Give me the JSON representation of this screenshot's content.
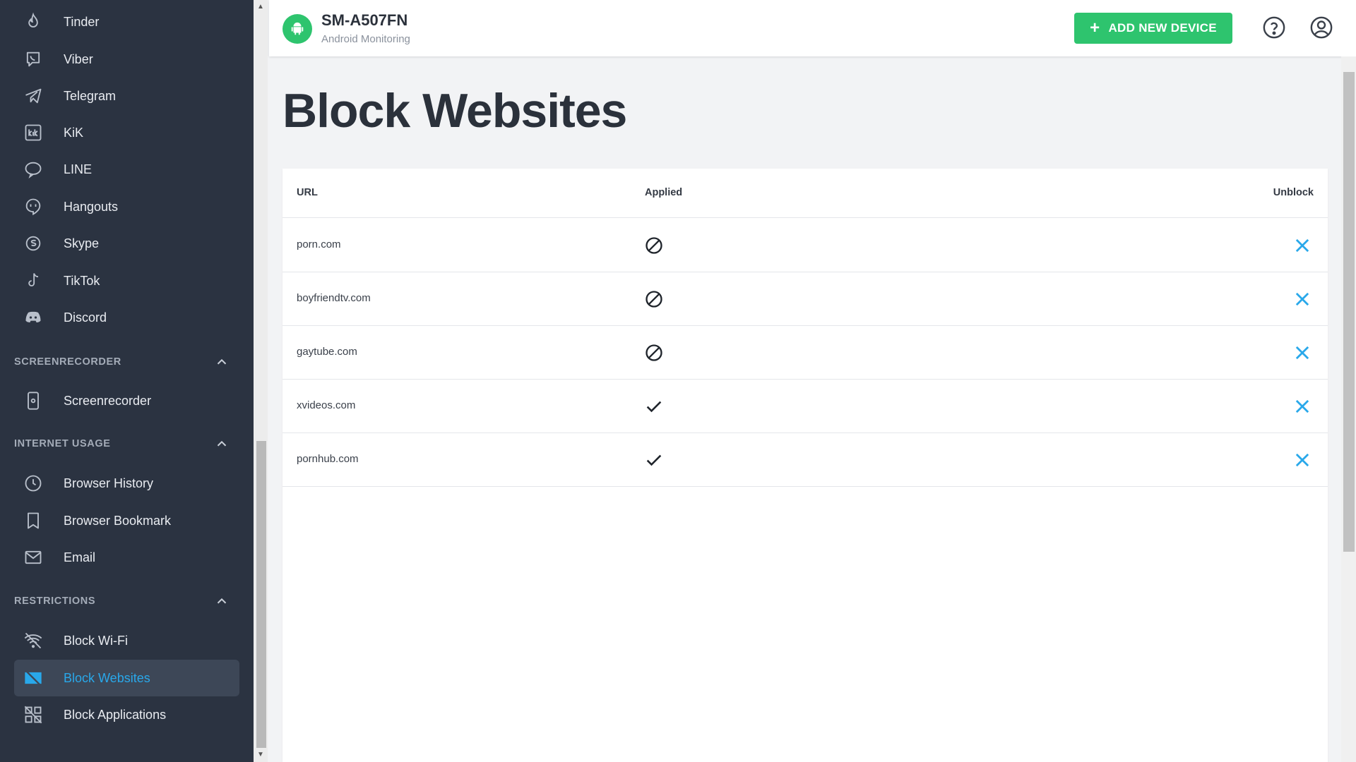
{
  "sidebar": {
    "apps": [
      {
        "label": "Tinder",
        "icon": "flame-icon"
      },
      {
        "label": "Viber",
        "icon": "viber-icon"
      },
      {
        "label": "Telegram",
        "icon": "telegram-icon"
      },
      {
        "label": "KiK",
        "icon": "kik-icon"
      },
      {
        "label": "LINE",
        "icon": "line-icon"
      },
      {
        "label": "Hangouts",
        "icon": "hangouts-icon"
      },
      {
        "label": "Skype",
        "icon": "skype-icon"
      },
      {
        "label": "TikTok",
        "icon": "tiktok-icon"
      },
      {
        "label": "Discord",
        "icon": "discord-icon"
      }
    ],
    "sections": [
      {
        "title": "SCREENRECORDER",
        "items": [
          {
            "label": "Screenrecorder",
            "icon": "phone-record-icon"
          }
        ]
      },
      {
        "title": "INTERNET USAGE",
        "items": [
          {
            "label": "Browser History",
            "icon": "clock-icon"
          },
          {
            "label": "Browser Bookmark",
            "icon": "bookmark-icon"
          },
          {
            "label": "Email",
            "icon": "mail-icon"
          }
        ]
      },
      {
        "title": "RESTRICTIONS",
        "items": [
          {
            "label": "Block Wi-Fi",
            "icon": "wifi-off-icon"
          },
          {
            "label": "Block Websites",
            "icon": "block-websites-icon",
            "active": true
          },
          {
            "label": "Block Applications",
            "icon": "block-apps-icon"
          }
        ]
      }
    ]
  },
  "header": {
    "device_name": "SM-A507FN",
    "device_subtitle": "Android Monitoring",
    "add_device_label": "ADD NEW DEVICE"
  },
  "page": {
    "title": "Block Websites"
  },
  "table": {
    "columns": [
      "URL",
      "Applied",
      "Unblock"
    ],
    "rows": [
      {
        "url": "porn.com",
        "applied": "pending"
      },
      {
        "url": "boyfriendtv.com",
        "applied": "pending"
      },
      {
        "url": "gaytube.com",
        "applied": "pending"
      },
      {
        "url": "xvideos.com",
        "applied": "applied"
      },
      {
        "url": "pornhub.com",
        "applied": "applied"
      }
    ]
  },
  "colors": {
    "sidebar_bg": "#2b3341",
    "accent_green": "#2ec46e",
    "accent_blue": "#29a8ea"
  }
}
